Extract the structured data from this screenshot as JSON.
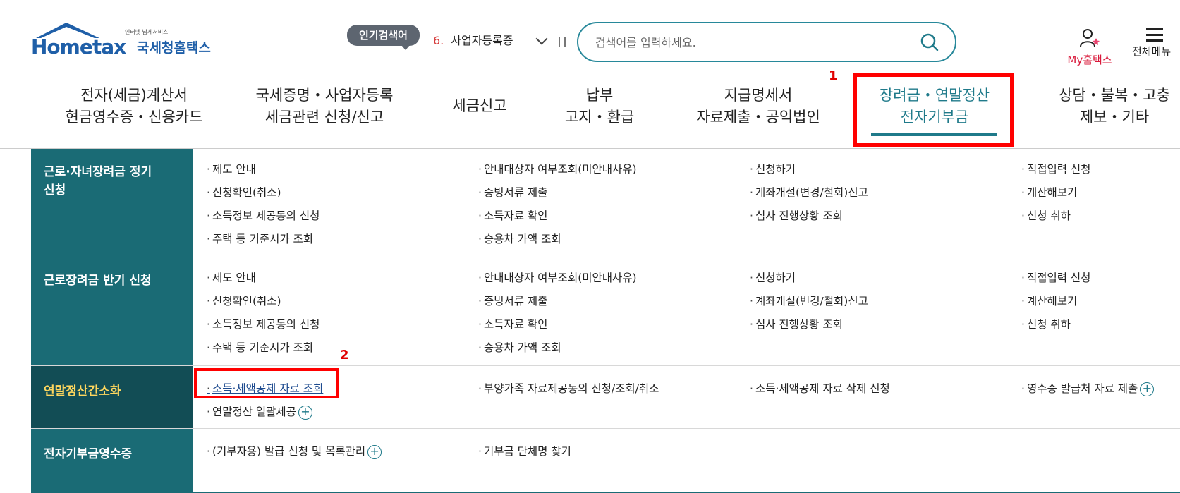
{
  "logo": {
    "tagline": "인터넷 납세서비스",
    "name_en": "Hometax",
    "name_kr": "국세청홈택스"
  },
  "popular_search": {
    "badge": "인기검색어",
    "rank": "6.",
    "term": "사업자등록증"
  },
  "search": {
    "placeholder": "검색어를 입력하세요."
  },
  "utility": {
    "my_home": "My홈택스",
    "all_menu": "전체메뉴"
  },
  "gnb": {
    "items": [
      {
        "line1": "전자(세금)계산서",
        "line2": "현금영수증・신용카드"
      },
      {
        "line1": "국세증명・사업자등록",
        "line2": "세금관련 신청/신고"
      },
      {
        "line1": "세금신고",
        "line2": ""
      },
      {
        "line1": "납부",
        "line2": "고지・환급"
      },
      {
        "line1": "지급명세서",
        "line2": "자료제출・공익법인"
      },
      {
        "line1": "장려금・연말정산",
        "line2": "전자기부금"
      },
      {
        "line1": "상담・불복・고충",
        "line2": "제보・기타"
      }
    ],
    "active_index": 5
  },
  "markers": {
    "step1": "1",
    "step2": "2"
  },
  "submenu": {
    "sections": [
      {
        "title_line1": "근로·자녀장려금 정기",
        "title_line2": "신청",
        "links": [
          [
            "제도 안내",
            "안내대상자 여부조회(미안내사유)",
            "신청하기",
            "직접입력 신청"
          ],
          [
            "신청확인(취소)",
            "증빙서류 제출",
            "계좌개설(변경/철회)신고",
            "계산해보기"
          ],
          [
            "소득정보 제공동의 신청",
            "소득자료 확인",
            "심사 진행상황 조회",
            "신청 취하"
          ],
          [
            "주택 등 기준시가 조회",
            "승용차 가액 조회"
          ]
        ]
      },
      {
        "title_line1": "근로장려금 반기 신청",
        "title_line2": "",
        "links": [
          [
            "제도 안내",
            "안내대상자 여부조회(미안내사유)",
            "신청하기",
            "직접입력 신청"
          ],
          [
            "신청확인(취소)",
            "증빙서류 제출",
            "계좌개설(변경/철회)신고",
            "계산해보기"
          ],
          [
            "소득정보 제공동의 신청",
            "소득자료 확인",
            "심사 진행상황 조회",
            "신청 취하"
          ],
          [
            "주택 등 기준시가 조회",
            "승용차 가액 조회"
          ]
        ]
      },
      {
        "title_line1": "연말정산간소화",
        "title_line2": "",
        "links": [
          [
            "소득·세액공제 자료 조회",
            "부양가족 자료제공동의 신청/조회/취소",
            "소득·세액공제 자료 삭제 신청",
            "영수증 발급처 자료 제출"
          ],
          [
            "연말정산 일괄제공"
          ]
        ]
      },
      {
        "title_line1": "전자기부금영수증",
        "title_line2": "",
        "links": [
          [
            "(기부자용) 발급 신청 및 목록관리",
            "기부금 단체명 찾기"
          ]
        ]
      }
    ]
  },
  "colors": {
    "brand_teal": "#1a6b75",
    "brand_blue": "#1f5fa8",
    "highlight_red": "#ff0000",
    "my_home_red": "#d9183a"
  }
}
